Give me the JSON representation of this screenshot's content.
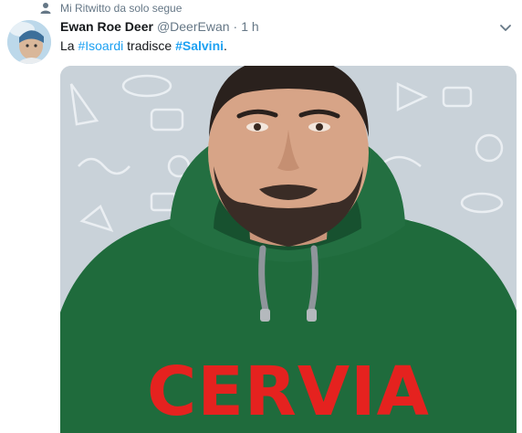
{
  "retweet": {
    "text": "Mi Ritwitto da solo segue",
    "icon": "user-icon"
  },
  "tweet": {
    "author_name": "Ewan Roe Deer",
    "handle": "@DeerEwan",
    "separator": "·",
    "time": "1 h",
    "text_before": "La ",
    "hashtag1": "#Isoardi",
    "text_middle": " tradisce ",
    "hashtag2": "#Salvini",
    "text_after": "."
  },
  "media": {
    "caption": "CERVIA"
  },
  "colors": {
    "link": "#1da1f2",
    "muted": "#657786",
    "caption": "#e5221f",
    "hoodie": "#1f6b3c"
  }
}
